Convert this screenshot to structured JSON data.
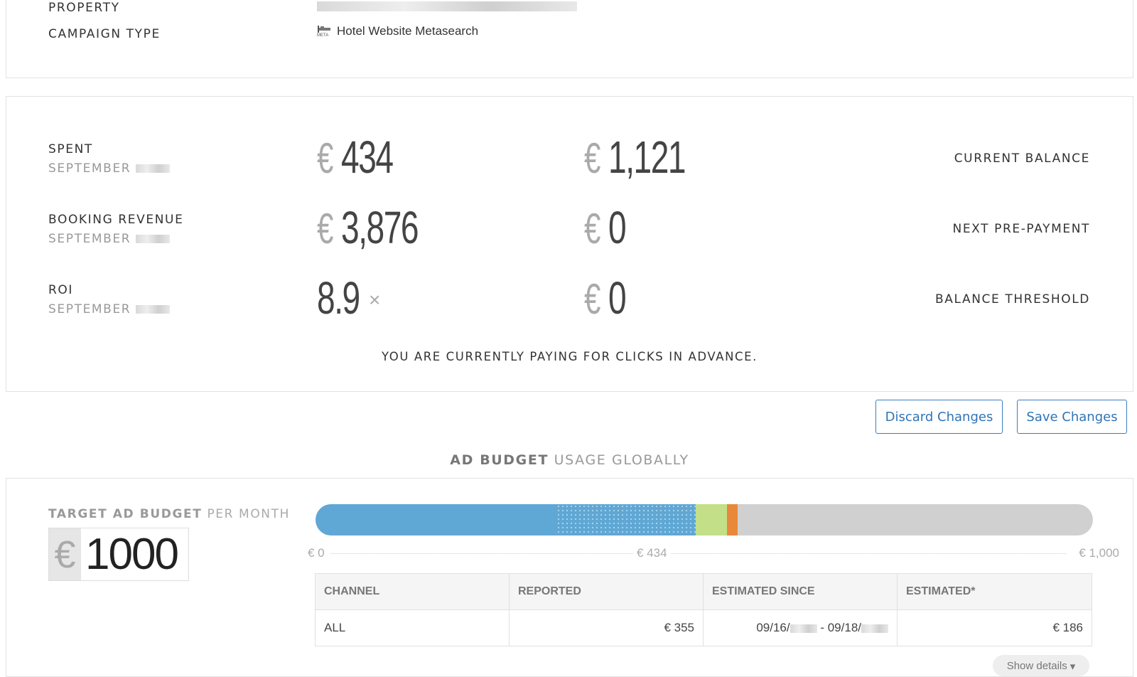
{
  "info": {
    "property_label": "PROPERTY",
    "campaign_type_label": "CAMPAIGN TYPE",
    "campaign_type_value": "Hotel Website Metasearch",
    "meta_icon_text": "META"
  },
  "stats": {
    "spent_label": "SPENT",
    "spent_sub": "SEPTEMBER",
    "spent_currency": "€",
    "spent_value": "434",
    "revenue_label": "BOOKING REVENUE",
    "revenue_sub": "SEPTEMBER",
    "revenue_currency": "€",
    "revenue_value": "3,876",
    "roi_label": "ROI",
    "roi_sub": "SEPTEMBER",
    "roi_value": "8.9",
    "roi_unit": "×",
    "balance_currency": "€",
    "balance_value": "1,121",
    "balance_label": "CURRENT BALANCE",
    "prepay_currency": "€",
    "prepay_value": "0",
    "prepay_label": "NEXT PRE-PAYMENT",
    "threshold_currency": "€",
    "threshold_value": "0",
    "threshold_label": "BALANCE THRESHOLD",
    "notice": "YOU ARE CURRENTLY PAYING FOR CLICKS IN ADVANCE."
  },
  "actions": {
    "discard_label": "Discard Changes",
    "save_label": "Save Changes"
  },
  "budget": {
    "heading_bold": "AD BUDGET",
    "heading_light": "USAGE GLOBALLY",
    "target_label_bold": "TARGET AD BUDGET",
    "target_label_light": "PER MONTH",
    "currency": "€",
    "target_value": "1000",
    "scale_min": "€ 0",
    "scale_mid": "€ 434",
    "scale_max": "€ 1,000",
    "bar_segments": [
      {
        "name": "reported",
        "fraction": 0.31,
        "color": "#5fa7d4"
      },
      {
        "name": "estimated",
        "fraction": 0.179,
        "color": "#5fa7d4"
      },
      {
        "name": "green",
        "fraction": 0.04,
        "color": "#c3df88"
      },
      {
        "name": "orange",
        "fraction": 0.014,
        "color": "#e8883a"
      }
    ],
    "bar_track_color": "#d0d0d0"
  },
  "channels": {
    "headers": [
      "CHANNEL",
      "REPORTED",
      "ESTIMATED SINCE",
      "ESTIMATED*"
    ],
    "rows": [
      {
        "channel": "ALL",
        "reported": "€ 355",
        "since_a": "09/16/",
        "since_sep": "- 09/18/",
        "estimated": "€ 186"
      }
    ],
    "show_details": "Show details"
  }
}
